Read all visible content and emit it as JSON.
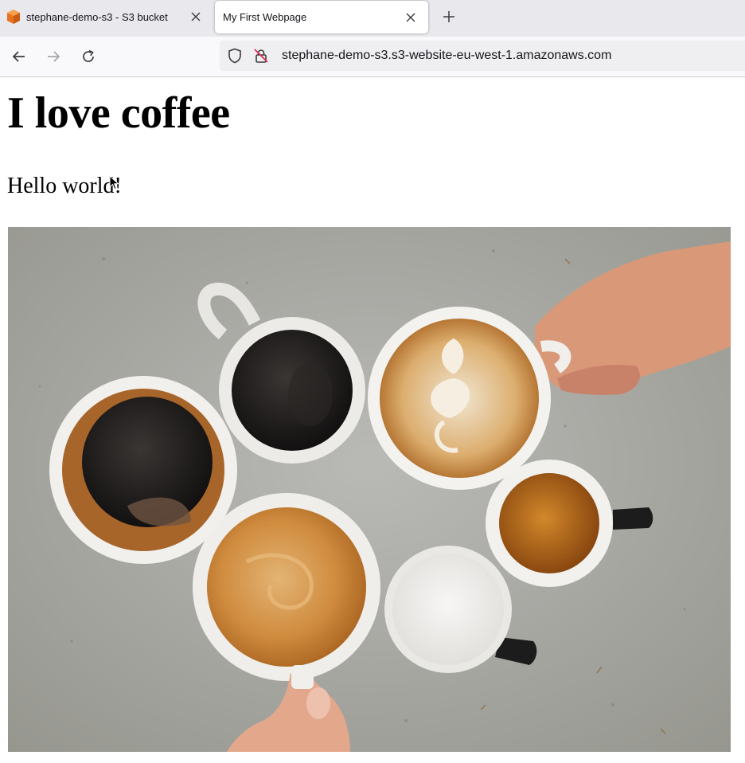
{
  "browser": {
    "tabs": [
      {
        "title": "stephane-demo-s3 - S3 bucket",
        "active": false,
        "favicon": "aws-s3-cube-icon"
      },
      {
        "title": "My First Webpage",
        "active": true,
        "favicon": ""
      }
    ],
    "url": "stephane-demo-s3.s3-website-eu-west-1.amazonaws.com",
    "nav_icons": [
      "back-arrow-icon",
      "forward-arrow-icon",
      "reload-icon"
    ],
    "url_icons": [
      "tracking-shield-icon",
      "insecure-lock-icon"
    ]
  },
  "page": {
    "heading": "I love coffee",
    "paragraph": "Hello world!",
    "image": {
      "subject": "coffee-cups-photo"
    }
  },
  "colors": {
    "tabbar_bg": "#e8e8ed",
    "navbar_bg": "#f9f9fb",
    "aws_orange": "#e8731e",
    "table_concrete": "#a8a8a5"
  }
}
